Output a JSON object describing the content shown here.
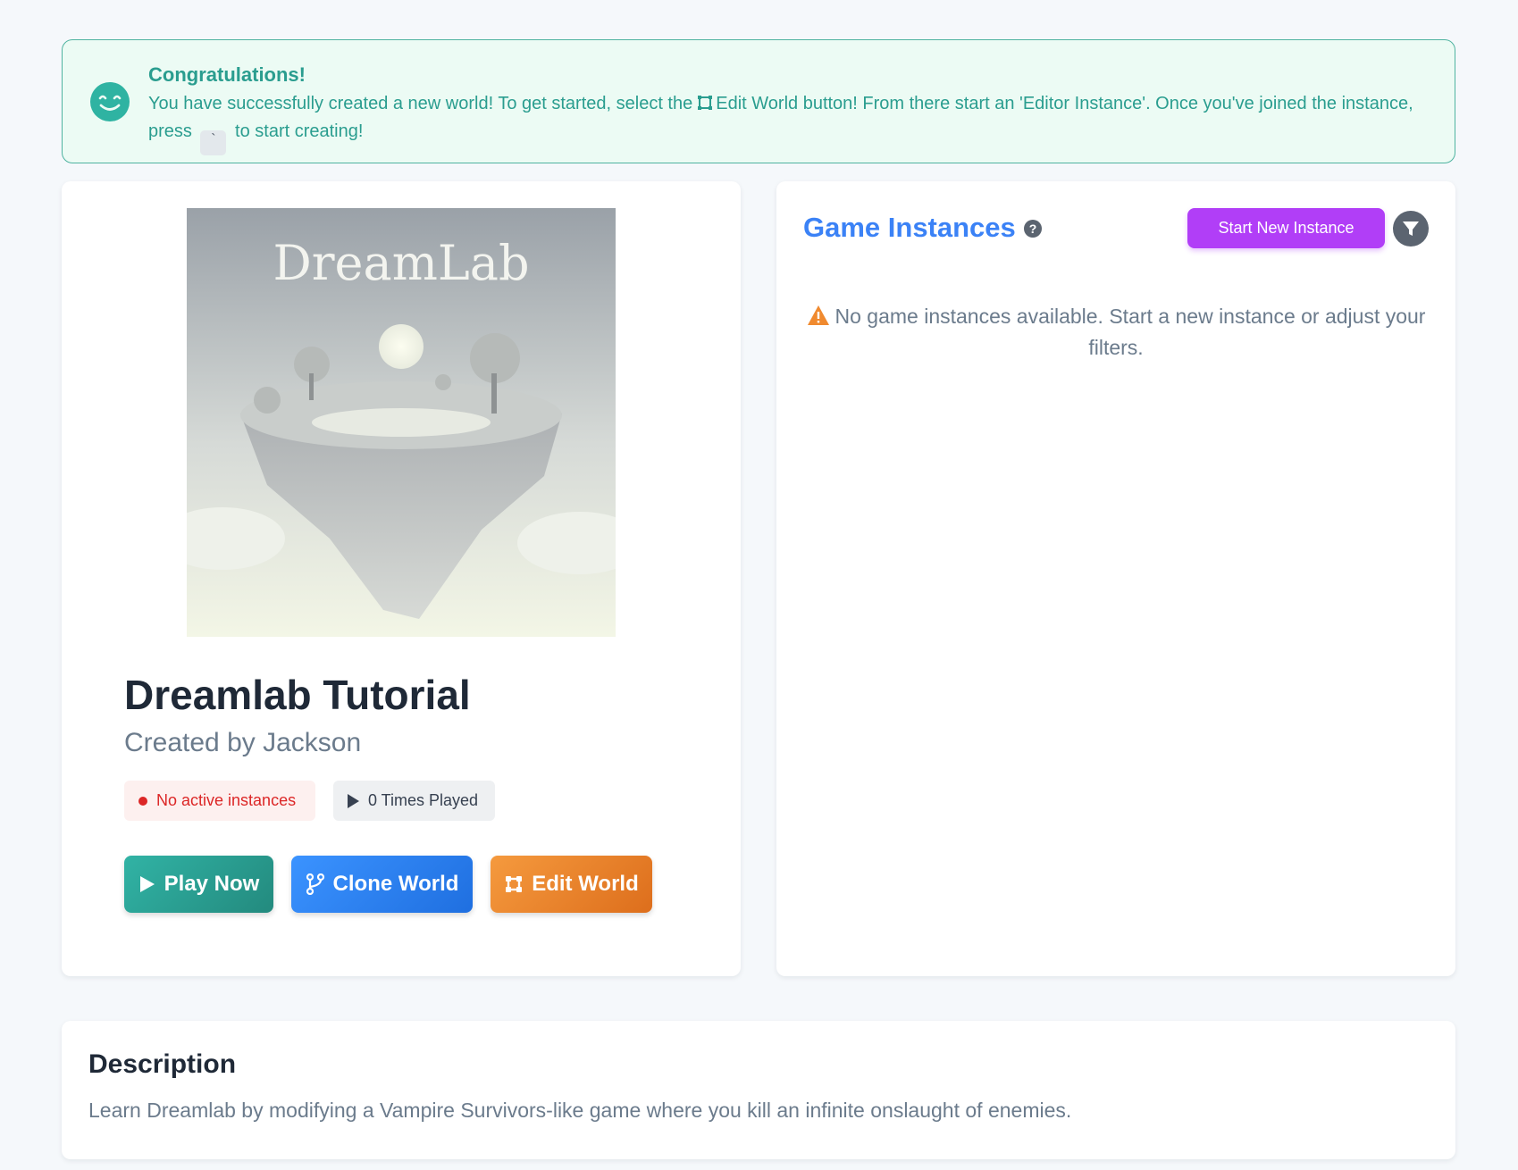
{
  "alert": {
    "title": "Congratulations!",
    "body_part1": "You have successfully created a new world! To get started, select the",
    "body_part2": "Edit World button! From there start an 'Editor Instance'. Once you've joined the instance, press",
    "key": "`",
    "body_part3": "to start creating!",
    "icon": "smile-icon",
    "color": "#2a9d8f"
  },
  "world": {
    "cover_logo_text": "DreamLab",
    "title": "Dreamlab Tutorial",
    "creator": "Created by Jackson",
    "status_badge": "No active instances",
    "times_played": "0 Times Played",
    "buttons": {
      "play": "Play Now",
      "clone": "Clone World",
      "edit": "Edit World"
    }
  },
  "instances": {
    "title": "Game Instances",
    "help_icon": "?",
    "start_button": "Start New Instance",
    "empty_message": "No game instances available. Start a new instance or adjust your filters.",
    "filter_icon": "filter-icon"
  },
  "description": {
    "title": "Description",
    "text": "Learn Dreamlab by modifying a Vampire Survivors-like game where you kill an infinite onslaught of enemies."
  },
  "colors": {
    "accent_blue": "#3b82f6",
    "accent_purple": "#b13ef7",
    "play": "#2a9d8f",
    "edit": "#f08a2f",
    "danger": "#dc2626"
  }
}
